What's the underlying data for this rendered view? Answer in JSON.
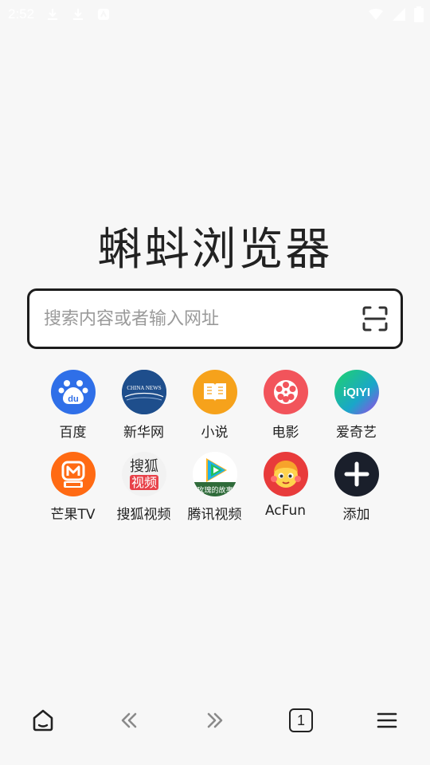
{
  "status_bar": {
    "time": "2:52",
    "icons": [
      "download-icon",
      "download-icon",
      "notification-icon",
      "wifi-icon",
      "signal-icon",
      "battery-icon"
    ]
  },
  "app": {
    "title": "蝌蚪浏览器"
  },
  "search": {
    "placeholder": "搜索内容或者输入网址",
    "value": ""
  },
  "shortcuts": [
    {
      "label": "百度",
      "icon": "baidu-icon",
      "color": "#2f6fe8"
    },
    {
      "label": "新华网",
      "icon": "xinhua-icon",
      "color": "#1e4e8c",
      "icon_text": "CHINA NEWS"
    },
    {
      "label": "小说",
      "icon": "book-icon",
      "color": "#f6a21b"
    },
    {
      "label": "电影",
      "icon": "film-reel-icon",
      "color": "#f2545b"
    },
    {
      "label": "爱奇艺",
      "icon": "iqiyi-icon",
      "color": "#21c05c",
      "icon_text": "iQIYI"
    },
    {
      "label": "芒果TV",
      "icon": "mango-tv-icon",
      "color": "#ff6a13"
    },
    {
      "label": "搜狐视频",
      "icon": "sohu-video-icon",
      "color": "#e8e8e8",
      "icon_text": "搜狐视频"
    },
    {
      "label": "腾讯视频",
      "icon": "tencent-video-icon",
      "color": "#1fb2e7"
    },
    {
      "label": "AcFun",
      "icon": "acfun-icon",
      "color": "#e83b3b"
    },
    {
      "label": "添加",
      "icon": "plus-icon",
      "color": "#1a1f2b"
    }
  ],
  "bottom_nav": {
    "tab_count": "1",
    "items": [
      "home-icon",
      "back-icon",
      "forward-icon",
      "tabs-icon",
      "menu-icon"
    ]
  }
}
